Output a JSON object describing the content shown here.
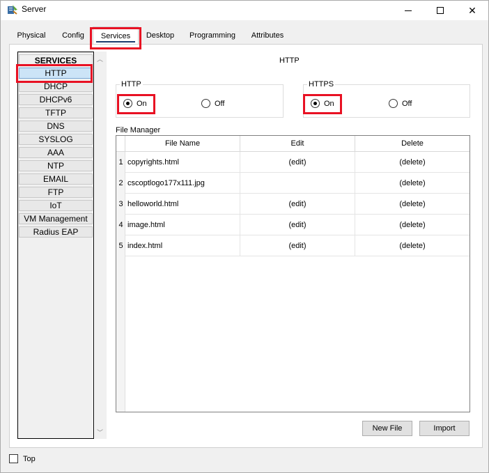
{
  "window": {
    "title": "Server"
  },
  "tabs": [
    {
      "label": "Physical"
    },
    {
      "label": "Config"
    },
    {
      "label": "Services"
    },
    {
      "label": "Desktop"
    },
    {
      "label": "Programming"
    },
    {
      "label": "Attributes"
    }
  ],
  "services": {
    "header": "SERVICES",
    "items": [
      "HTTP",
      "DHCP",
      "DHCPv6",
      "TFTP",
      "DNS",
      "SYSLOG",
      "AAA",
      "NTP",
      "EMAIL",
      "FTP",
      "IoT",
      "VM Management",
      "Radius EAP"
    ],
    "selected": "HTTP"
  },
  "panel": {
    "title": "HTTP",
    "http": {
      "label": "HTTP",
      "on": "On",
      "off": "Off",
      "value": "On"
    },
    "https": {
      "label": "HTTPS",
      "on": "On",
      "off": "Off",
      "value": "On"
    }
  },
  "file_manager": {
    "label": "File Manager",
    "columns": [
      "File Name",
      "Edit",
      "Delete"
    ],
    "rows": [
      {
        "num": "1",
        "name": "copyrights.html",
        "edit": "(edit)",
        "delete": "(delete)"
      },
      {
        "num": "2",
        "name": "cscoptlogo177x111.jpg",
        "edit": "",
        "delete": "(delete)"
      },
      {
        "num": "3",
        "name": "helloworld.html",
        "edit": "(edit)",
        "delete": "(delete)"
      },
      {
        "num": "4",
        "name": "image.html",
        "edit": "(edit)",
        "delete": "(delete)"
      },
      {
        "num": "5",
        "name": "index.html",
        "edit": "(edit)",
        "delete": "(delete)"
      }
    ]
  },
  "buttons": {
    "new_file": "New File",
    "import": "Import"
  },
  "top_checkbox": {
    "label": "Top"
  },
  "colors": {
    "highlight": "#e81123",
    "selected_bg": "#cce4f7",
    "tab_underline": "#1a3c6e"
  }
}
